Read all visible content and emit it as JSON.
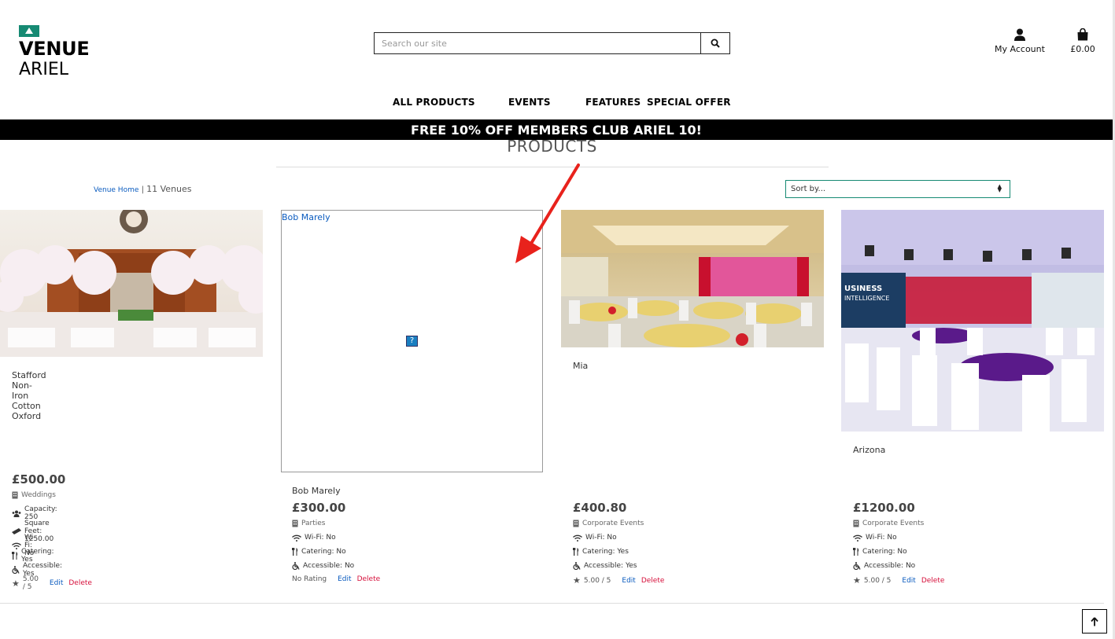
{
  "brand": {
    "line1": "VENUE",
    "line2": "ARIEL",
    "color": "#168a73"
  },
  "search": {
    "placeholder": "Search our site",
    "icon": "search-icon"
  },
  "header": {
    "account_label": "My Account",
    "cart_total": "£0.00"
  },
  "nav": {
    "items": [
      "ALL PRODUCTS",
      "EVENTS",
      "FEATURES",
      "SPECIAL OFFER"
    ]
  },
  "banner": "FREE 10% OFF MEMBERS CLUB ARIEL 10!",
  "page_title": "PRODUCTS",
  "breadcrumb": {
    "home": "Venue Home",
    "separator": "|",
    "count": "11 Venues"
  },
  "sort": {
    "selected": "Sort by..."
  },
  "products": [
    {
      "name": "Stafford Non-Iron Cotton Oxford",
      "price": "£500.00",
      "category": "Weddings",
      "capacity": "Capacity: 250",
      "square_feet": "Square Feet: 1250.00",
      "wifi": "Wi-Fi: No",
      "catering": "Catering: Yes",
      "accessible": "Accessible: Yes",
      "rating": "5.00 / 5",
      "edit": "Edit",
      "delete": "Delete"
    },
    {
      "name": "Bob Marely",
      "image_alt": "Bob Marely",
      "price": "£300.00",
      "category": "Parties",
      "wifi": "Wi-Fi: No",
      "catering": "Catering: No",
      "accessible": "Accessible: No",
      "rating": "No Rating",
      "edit": "Edit",
      "delete": "Delete"
    },
    {
      "name": "Mia",
      "price": "£400.80",
      "category": "Corporate Events",
      "wifi": "Wi-Fi: No",
      "catering": "Catering: Yes",
      "accessible": "Accessible: Yes",
      "rating": "5.00 / 5",
      "edit": "Edit",
      "delete": "Delete"
    },
    {
      "name": "Arizona",
      "price": "£1200.00",
      "category": "Corporate Events",
      "wifi": "Wi-Fi: No",
      "catering": "Catering: No",
      "accessible": "Accessible: No",
      "rating": "5.00 / 5",
      "edit": "Edit",
      "delete": "Delete"
    }
  ],
  "colors": {
    "link": "#0a5bbf",
    "delete": "#d6103b",
    "banner_bg": "#000000",
    "annotation_arrow": "#e8221c"
  }
}
